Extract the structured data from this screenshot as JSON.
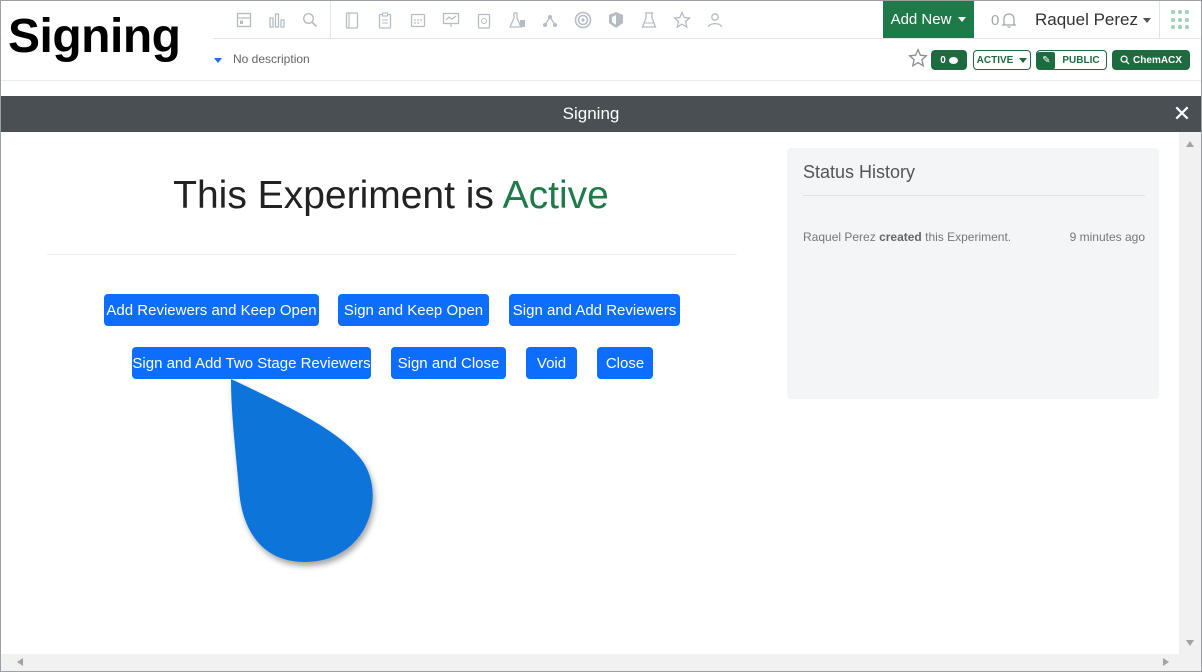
{
  "page": {
    "heading": "Signing"
  },
  "navbar": {
    "add_new_label": "Add New",
    "notification_count": "0",
    "user_name": "Raquel Perez",
    "icons": [
      "dashboard-icon",
      "bar-chart-icon",
      "search-icon",
      "notebook-icon",
      "clipboard-icon",
      "calendar-icon",
      "presentation-icon",
      "report-icon",
      "lab-flask-icon",
      "molecule-icon",
      "target-icon",
      "shield-icon",
      "beaker-icon",
      "star-icon",
      "users-icon"
    ]
  },
  "toolbar": {
    "description_placeholder": "No description",
    "comment_count": "0",
    "status_label": "ACTIVE",
    "visibility_label": "PUBLIC",
    "chem_label": "ChemACX"
  },
  "modal": {
    "title": "Signing",
    "status_prefix": "This Experiment is",
    "status_value": "Active",
    "buttons": {
      "add_reviewers_keep_open": "Add Reviewers and Keep Open",
      "sign_keep_open": "Sign and Keep Open",
      "sign_add_reviewers": "Sign and Add Reviewers",
      "sign_add_two_stage": "Sign and Add Two Stage Reviewers",
      "sign_close": "Sign and Close",
      "void": "Void",
      "close": "Close"
    }
  },
  "history": {
    "title": "Status History",
    "entries": [
      {
        "user": "Raquel Perez",
        "action": "created",
        "object": "this Experiment.",
        "time": "9 minutes ago"
      }
    ]
  },
  "colors": {
    "brand_green": "#1f7a4a",
    "primary_blue": "#0d6efd",
    "modal_header": "#4a4f54",
    "pointer_blue": "#0a74d9"
  }
}
